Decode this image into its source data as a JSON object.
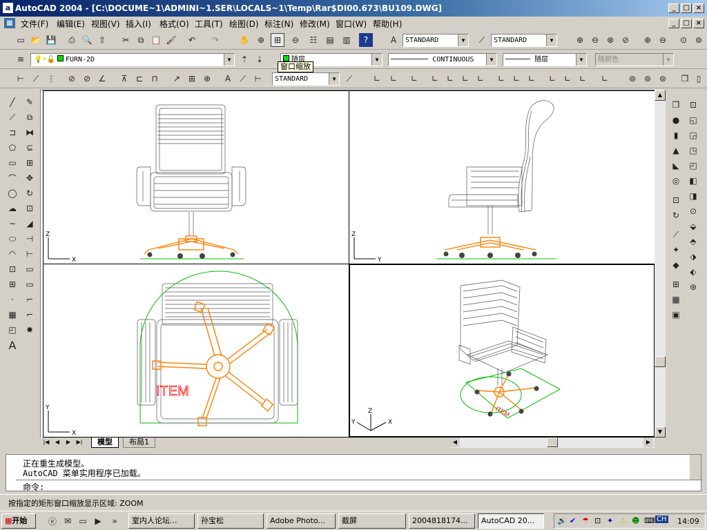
{
  "window": {
    "title": "AutoCAD 2004 - [C:\\DOCUME~1\\ADMINI~1.SER\\LOCALS~1\\Temp\\Rar$DI00.673\\BU109.DWG]",
    "app_icon": "a"
  },
  "menu": [
    "文件(F)",
    "编辑(E)",
    "视图(V)",
    "插入(I)",
    "格式(O)",
    "工具(T)",
    "绘图(D)",
    "标注(N)",
    "修改(M)",
    "窗口(W)",
    "帮助(H)"
  ],
  "toolbar": {
    "text_style": "STANDARD",
    "dim_style": "STANDARD",
    "layer_name": "FURN-2D",
    "color_value": "随层",
    "linetype_value": "CONTINUOUS",
    "lineweight_value": "随层",
    "plotstyle_value": "随颜色",
    "dim_combo": "STANDARD",
    "tooltip": "窗口缩放"
  },
  "viewports": {
    "labels": {
      "x": "X",
      "y": "Y",
      "z": "Z"
    },
    "item_text": "ITEM"
  },
  "tabs": {
    "model": "模型",
    "layout1": "布局1"
  },
  "command": {
    "history": [
      "正在重生成模型。",
      "AutoCAD 菜单实用程序已加载。"
    ],
    "prompt": "命令:",
    "status": "按指定的矩形窗口缩放显示区域: ZOOM"
  },
  "taskbar": {
    "start": "开始",
    "items": [
      "室内人论坛...",
      "孙宝松",
      "Adobe Photo...",
      "截屏",
      "2004818174...",
      "AutoCAD 20..."
    ],
    "lang": "CH",
    "clock": "14:09"
  },
  "colors": {
    "accent": "#ff8000",
    "green": "#00c000",
    "red": "#ff0000"
  }
}
